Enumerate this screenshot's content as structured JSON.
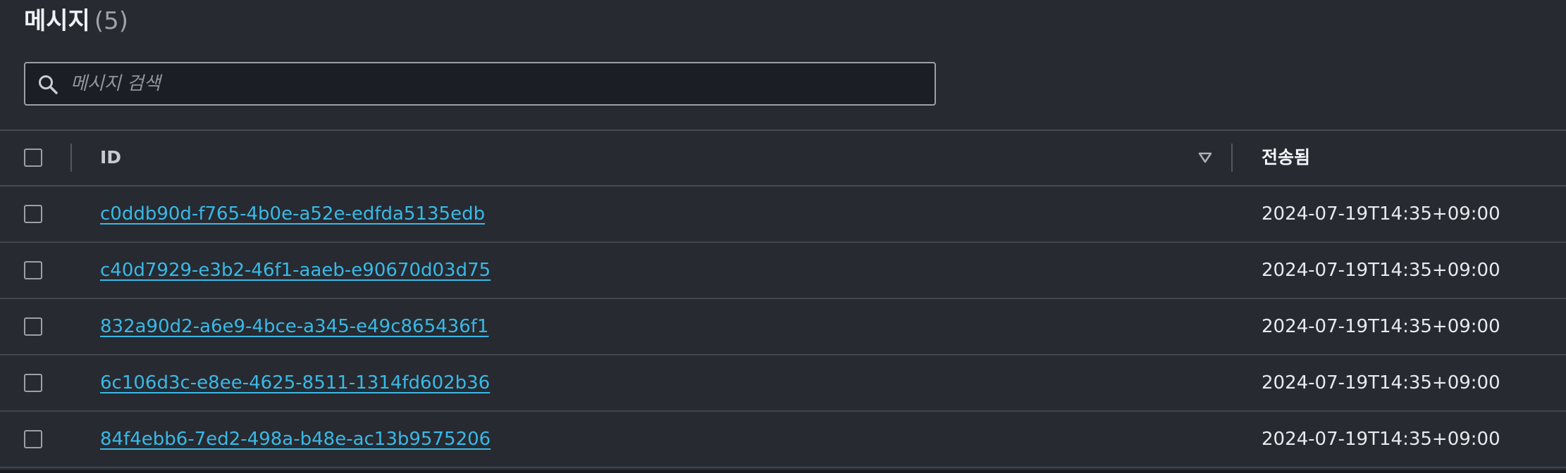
{
  "panel": {
    "title": "메시지",
    "count_label": "(5)"
  },
  "search": {
    "placeholder": "메시지 검색",
    "value": ""
  },
  "table": {
    "columns": [
      {
        "label": "ID",
        "sort_indicator": "descending"
      },
      {
        "label": "전송됨"
      }
    ],
    "rows": [
      {
        "id": "c0ddb90d-f765-4b0e-a52e-edfda5135edb",
        "sent": "2024-07-19T14:35+09:00"
      },
      {
        "id": "c40d7929-e3b2-46f1-aaeb-e90670d03d75",
        "sent": "2024-07-19T14:35+09:00"
      },
      {
        "id": "832a90d2-a6e9-4bce-a345-e49c865436f1",
        "sent": "2024-07-19T14:35+09:00"
      },
      {
        "id": "6c106d3c-e8ee-4625-8511-1314fd602b36",
        "sent": "2024-07-19T14:35+09:00"
      },
      {
        "id": "84f4ebb6-7ed2-498a-b48e-ac13b9575206",
        "sent": "2024-07-19T14:35+09:00"
      }
    ]
  },
  "colors": {
    "background": "#272a31",
    "link": "#39b9e6",
    "border": "#9aa1aa"
  },
  "icons": {
    "search": "search-icon",
    "sort": "sort-descending-icon"
  }
}
